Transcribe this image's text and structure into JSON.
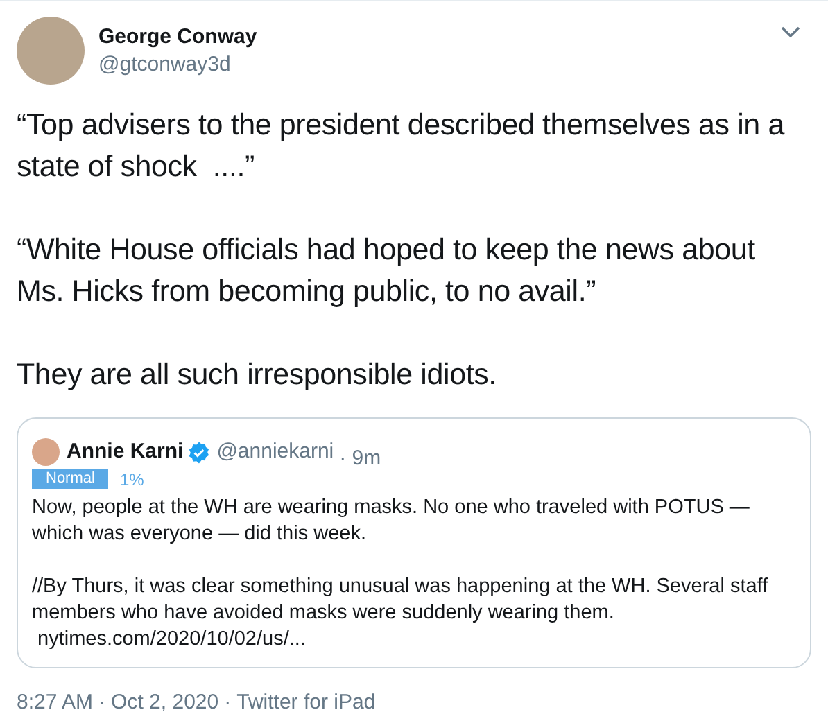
{
  "author": {
    "name": "George Conway",
    "handle": "@gtconway3d"
  },
  "paragraphs": [
    "“Top advisers to the president described themselves as in a state of shock  ....”",
    "“White House officials had hoped to keep the news about Ms. Hicks from becoming public, to no avail.”",
    "They are all such irresponsible idiots."
  ],
  "quoted": {
    "name": "Annie Karni",
    "verified": true,
    "handle": "@anniekarni",
    "time": "· 9m",
    "badge": "Normal",
    "percent": "1%",
    "paragraphs": [
      "Now, people at the WH are wearing masks. No one who traveled with POTUS — which was everyone — did this week.",
      "//By Thurs, it was clear something unusual was happening at the WH. Several staff members who have avoided masks were suddenly wearing them."
    ],
    "link": "nytimes.com/2020/10/02/us/..."
  },
  "footer": {
    "time": "8:27 AM",
    "separator_1": "·",
    "date": "Oct 2, 2020",
    "separator_2": "·",
    "source": "Twitter for iPad"
  }
}
